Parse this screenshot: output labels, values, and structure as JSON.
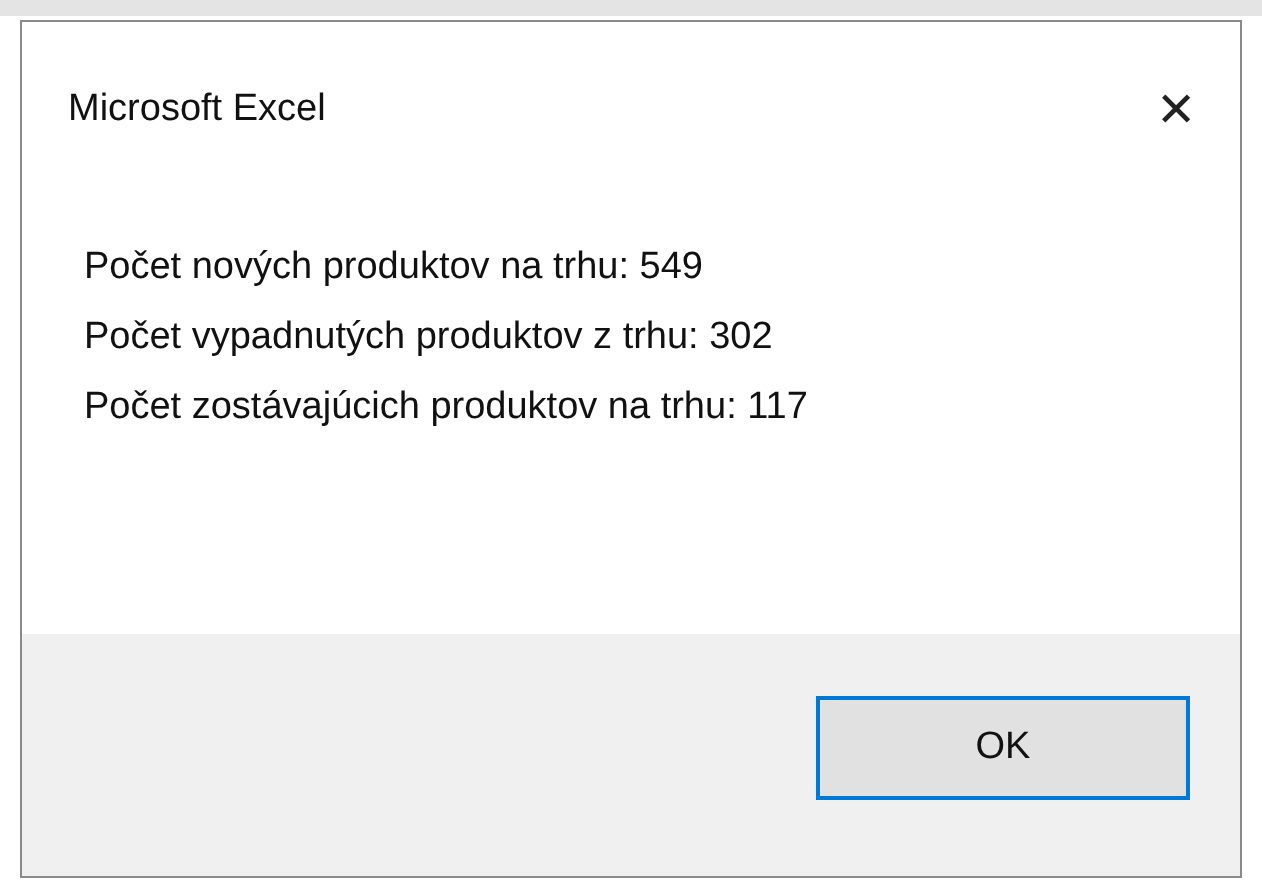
{
  "window": {
    "title": "Microsoft Excel",
    "close": "✕"
  },
  "message": [
    "Počet nových produktov na trhu: 549",
    "Počet vypadnutých produktov z trhu: 302",
    "Počet zostávajúcich produktov na trhu: 117"
  ],
  "buttons": [
    "OK"
  ]
}
